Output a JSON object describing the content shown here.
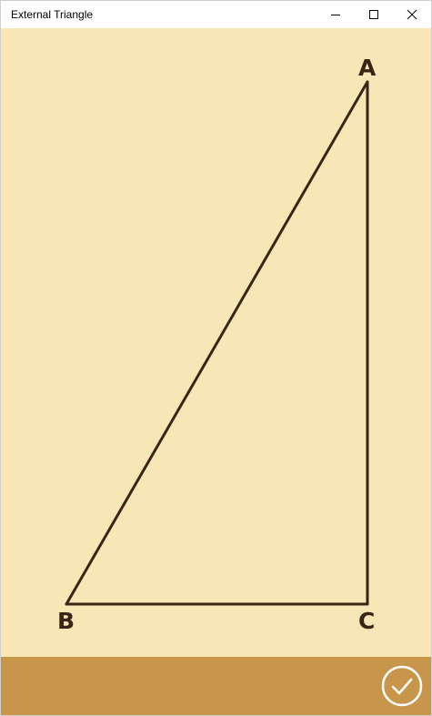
{
  "window": {
    "title": "External Triangle",
    "controls": {
      "minimize_icon": "minimize-icon",
      "maximize_icon": "maximize-icon",
      "close_icon": "close-icon"
    }
  },
  "canvas": {
    "background_color": "#f8e6b6",
    "line_color": "#3a2414",
    "vertices": {
      "a": "A",
      "b": "B",
      "c": "C"
    }
  },
  "bottom_bar": {
    "background_color": "#c8964a",
    "confirm_icon": "checkmark-circle-icon"
  }
}
